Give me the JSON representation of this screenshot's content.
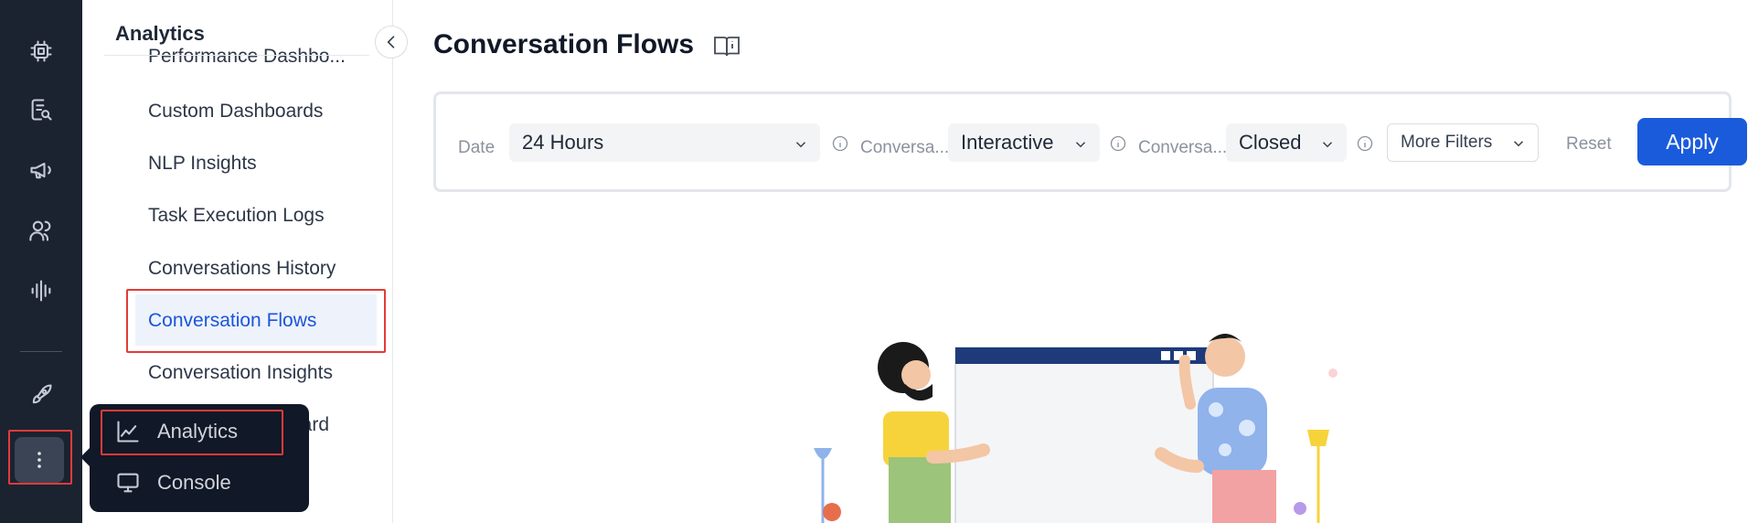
{
  "subnav": {
    "title": "Analytics",
    "items": [
      {
        "label": "Performance Dashbo..."
      },
      {
        "label": "Custom Dashboards"
      },
      {
        "label": "NLP Insights"
      },
      {
        "label": "Task Execution Logs"
      },
      {
        "label": "Conversations History"
      },
      {
        "label": "Conversation Flows",
        "active": true
      },
      {
        "label": "Conversation Insights"
      },
      {
        "label": "oard"
      }
    ]
  },
  "popup": {
    "items": [
      {
        "label": "Analytics",
        "icon": "line-chart-icon"
      },
      {
        "label": "Console",
        "icon": "monitor-icon"
      }
    ]
  },
  "main": {
    "title": "Conversation Flows"
  },
  "filters": {
    "date_label": "Date",
    "date_value": "24 Hours",
    "conv_type_label": "Conversa...",
    "conv_type_value": "Interactive",
    "conv_status_label": "Conversa...",
    "conv_status_value": "Closed",
    "more_filters": "More Filters",
    "reset": "Reset",
    "apply": "Apply"
  },
  "colors": {
    "rail_bg": "#1b2330",
    "accent": "#1a5bdc",
    "highlight": "#e23b3b"
  }
}
